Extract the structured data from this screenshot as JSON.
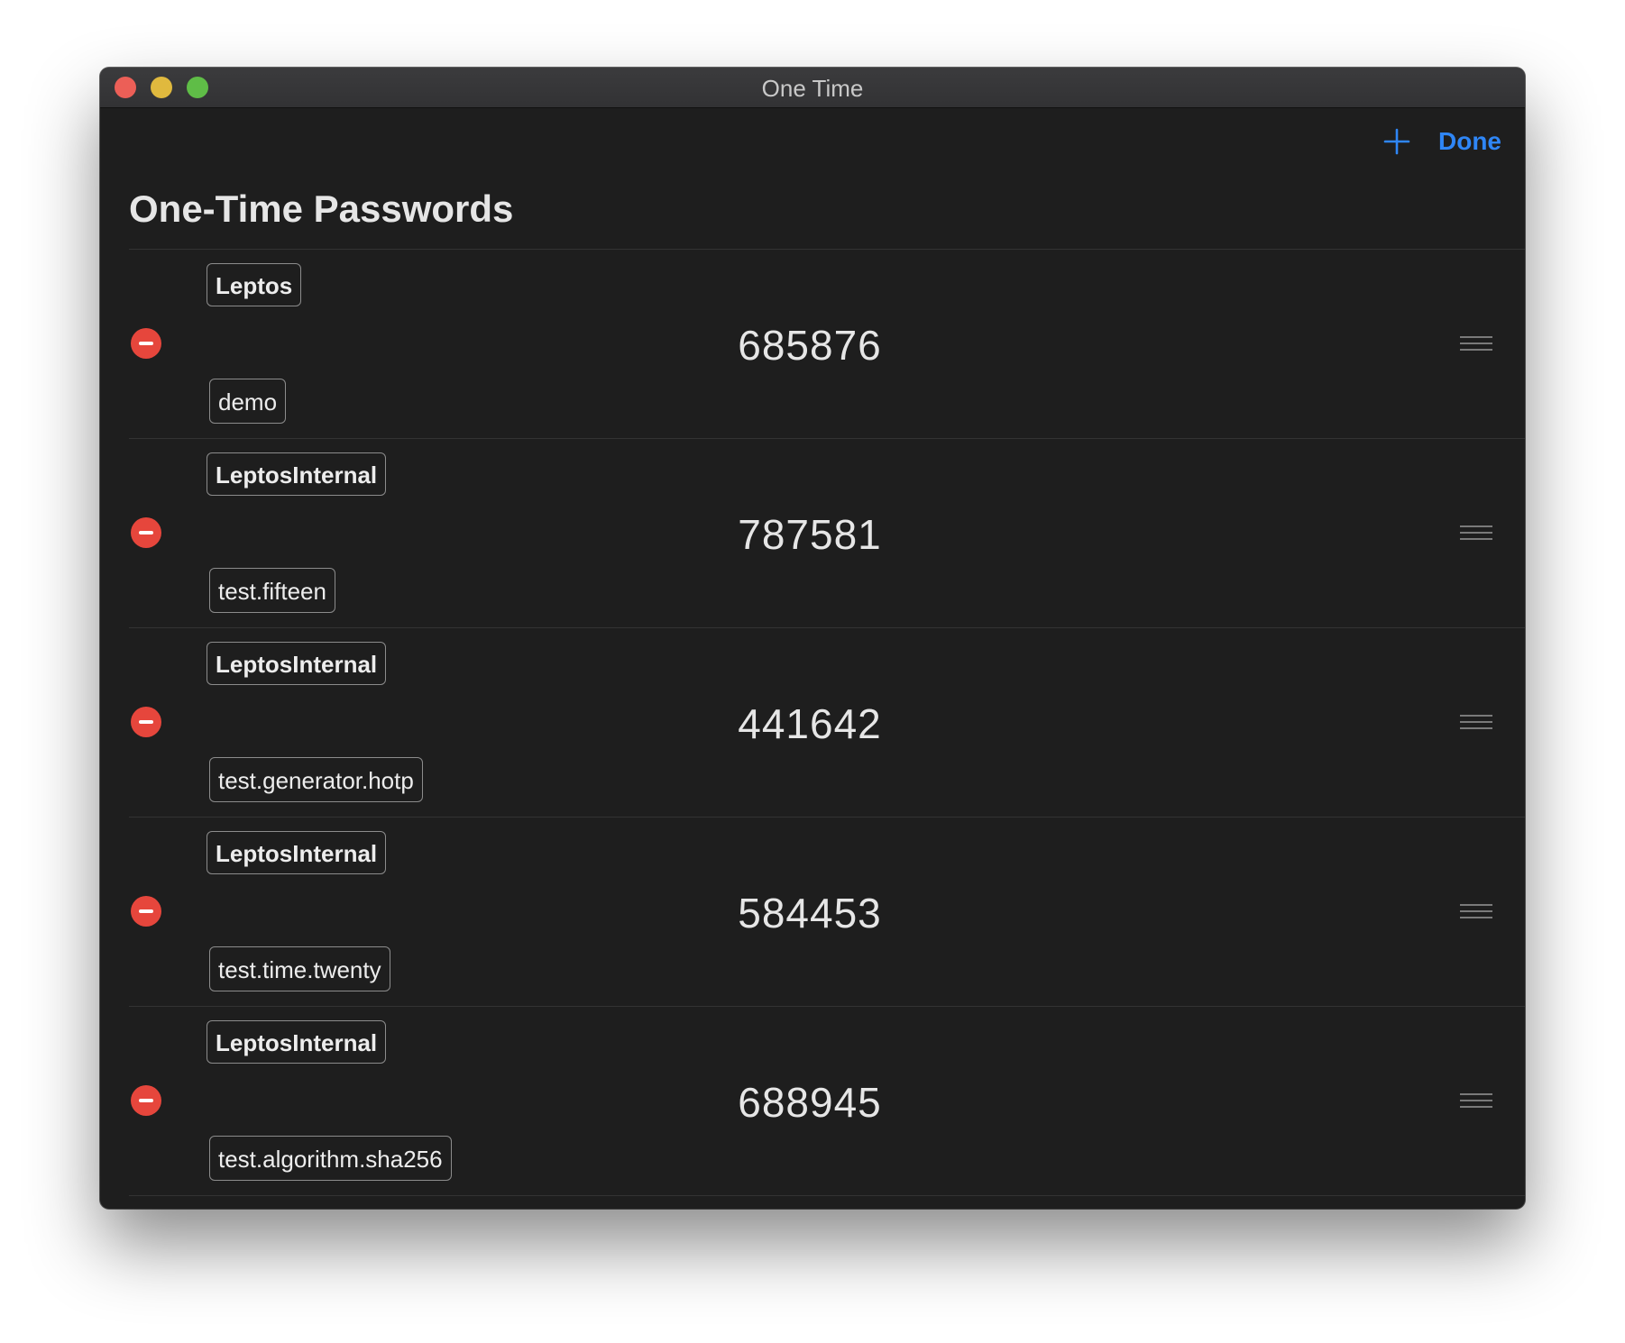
{
  "window": {
    "title": "One Time"
  },
  "toolbar": {
    "add_icon": "plus-icon",
    "done_label": "Done"
  },
  "page": {
    "title": "One-Time Passwords"
  },
  "entries": [
    {
      "issuer": "Leptos",
      "account": "demo",
      "code": "685876"
    },
    {
      "issuer": "LeptosInternal",
      "account": "test.fifteen",
      "code": "787581"
    },
    {
      "issuer": "LeptosInternal",
      "account": "test.generator.hotp",
      "code": "441642"
    },
    {
      "issuer": "LeptosInternal",
      "account": "test.time.twenty",
      "code": "584453"
    },
    {
      "issuer": "LeptosInternal",
      "account": "test.algorithm.sha256",
      "code": "688945"
    }
  ],
  "colors": {
    "accent": "#2f86f6",
    "delete": "#e6463c",
    "background": "#1e1e1e"
  }
}
